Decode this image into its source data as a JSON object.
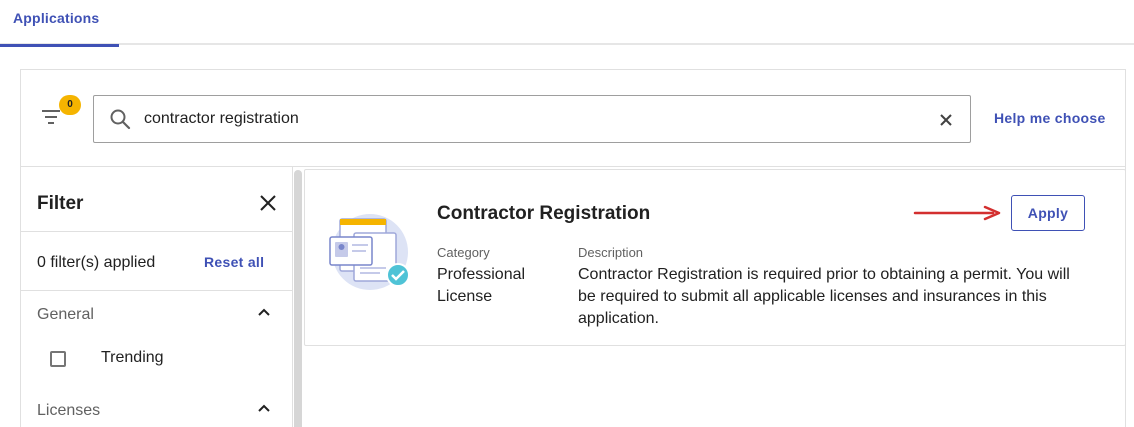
{
  "tabs": [
    {
      "label": "Applications",
      "active": true
    }
  ],
  "toolbar": {
    "filter_count": "0",
    "search": {
      "value": "contractor registration",
      "placeholder": ""
    },
    "help_label": "Help me choose"
  },
  "filter_panel": {
    "title": "Filter",
    "applied_text": "0 filter(s) applied",
    "reset_label": "Reset all",
    "sections": [
      {
        "label": "General",
        "expanded": true,
        "options": [
          {
            "label": "Trending",
            "checked": false
          }
        ]
      },
      {
        "label": "Licenses",
        "expanded": true
      }
    ]
  },
  "result": {
    "title": "Contractor Registration",
    "apply_label": "Apply",
    "category_label": "Category",
    "category_value": "Professional License",
    "description_label": "Description",
    "description_value": "Contractor Registration is required prior to obtaining a permit. You will be required to submit all applicable licenses and insurances in this application."
  },
  "colors": {
    "accent": "#3f51b5",
    "badge": "#f5b400",
    "annotation_arrow": "#d32f2f",
    "border": "#e0e0e0"
  },
  "icons": [
    "filter-icon",
    "search-icon",
    "close-icon",
    "chevron-up-icon",
    "application-illustration-icon",
    "arrow-annotation-icon"
  ]
}
